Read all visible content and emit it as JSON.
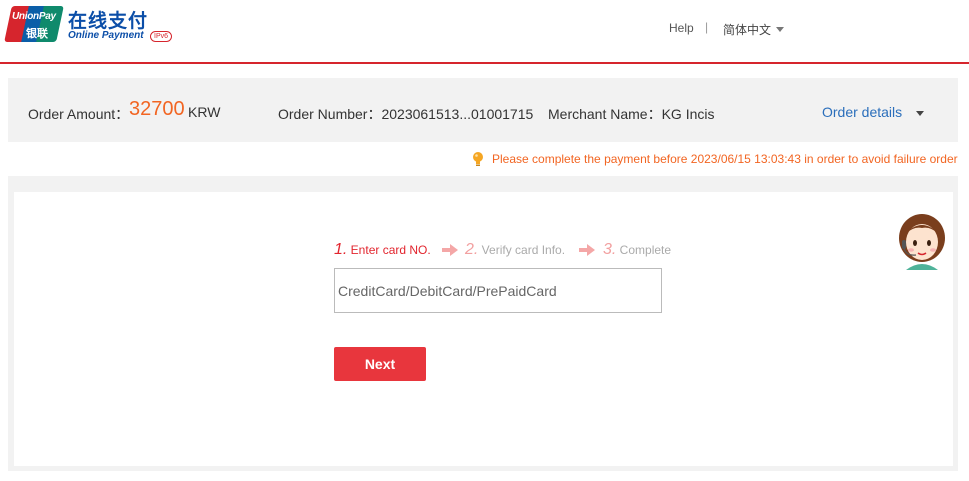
{
  "header": {
    "logo": {
      "en": "UnionPay",
      "cn": "银联"
    },
    "brand_cn": "在线支付",
    "brand_en": "Online Payment",
    "ipv6_badge": "IPv6",
    "help_link": "Help",
    "separator": "|",
    "language": "简体中文"
  },
  "order": {
    "amount_label": "Order Amount：",
    "amount_value": "32700",
    "currency": "KRW",
    "number": "Order Number：2023061513...01001715",
    "merchant": "Merchant Name：KG Incis",
    "details_link": "Order details"
  },
  "notice": {
    "text": "Please complete the payment before 2023/06/15 13:03:43 in order to avoid failure order",
    "icon": "lightbulb-icon"
  },
  "steps": [
    {
      "num": "1.",
      "label": " Enter card NO."
    },
    {
      "num": "2.",
      "label": " Verify card Info."
    },
    {
      "num": "3.",
      "label": " Complete"
    }
  ],
  "card_input": {
    "value": "",
    "placeholder": "CreditCard/DebitCard/PrePaidCard"
  },
  "next_button": "Next",
  "colors": {
    "brand_red": "#d6252d",
    "amount_orange": "#f26522",
    "link_blue": "#2a6ebb",
    "button_red": "#e8363d"
  }
}
